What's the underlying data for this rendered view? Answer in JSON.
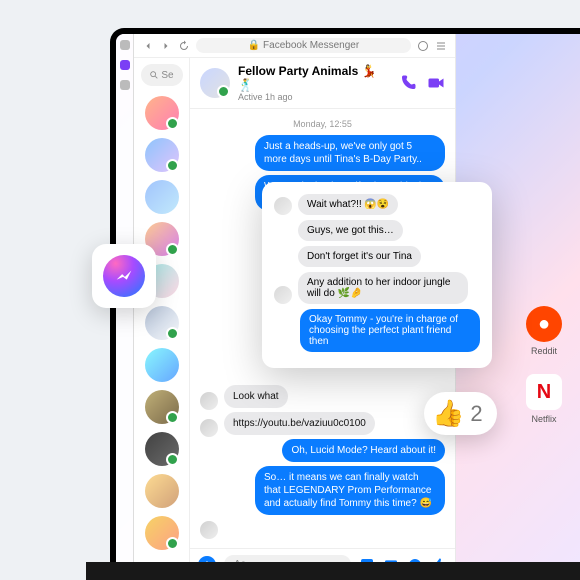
{
  "addressbar": {
    "title": "Facebook Messenger",
    "lock": "🔒"
  },
  "sidebar": {
    "search_placeholder": "Se"
  },
  "chat": {
    "title": "Fellow Party Animals 💃🕺",
    "subtitle": "Active 1h ago",
    "daystamp": "Monday, 12:55",
    "messages": {
      "m1": "Just a heads-up, we've only got 5 more days until Tina's B-Day Party..",
      "m2": "We need a backup gift, since shipping can take up to 1 week!",
      "m3": "Look what",
      "m4": "https://youtu.be/vaziuu0c0100",
      "m5": "Oh, Lucid Mode? Heard about it!",
      "m6": "So… it means we can finally watch that LEGENDARY Prom Performance and actually find Tommy this time? 😅"
    }
  },
  "composer": {
    "placeholder": "Aa"
  },
  "popup": {
    "p1": "Wait what?!! 😱😵",
    "p2": "Guys, we got this…",
    "p3": "Don't forget it's our Tina",
    "p4": "Any addition to her indoor jungle will do 🌿🤌",
    "p5": "Okay Tommy - you're in charge of choosing the perfect plant friend then"
  },
  "reaction": {
    "emoji": "👍",
    "count": "2"
  },
  "tiles": {
    "reddit": "Reddit",
    "netflix": "Netflix"
  }
}
